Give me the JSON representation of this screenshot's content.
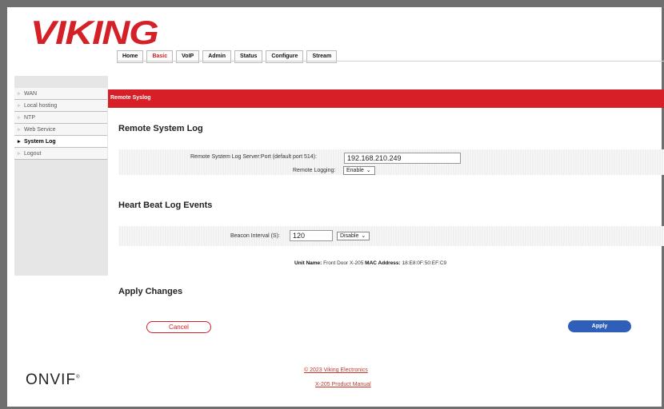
{
  "brand": {
    "logo": "VIKING"
  },
  "tabs": [
    "Home",
    "Basic",
    "VoIP",
    "Admin",
    "Status",
    "Configure",
    "Stream"
  ],
  "active_tab": "Basic",
  "sidebar": {
    "items": [
      {
        "label": "WAN"
      },
      {
        "label": "Local hosting"
      },
      {
        "label": "NTP"
      },
      {
        "label": "Web Service"
      },
      {
        "label": "System Log"
      },
      {
        "label": "Logout"
      }
    ],
    "active": "System Log"
  },
  "section_bar": {
    "title": "Remote Syslog"
  },
  "remote_log": {
    "heading": "Remote System Log",
    "server_label": "Remote System Log Server:Port (default port 514):",
    "server_value": "192.168.210.249",
    "logging_label": "Remote Logging:",
    "logging_value": "Enable"
  },
  "heartbeat": {
    "heading": "Heart Beat Log Events",
    "interval_label": "Beacon Interval (S):",
    "interval_value": "120",
    "state_value": "Disable"
  },
  "unit_info": {
    "name_label": "Unit Name:",
    "name_value": "Front Door X-205",
    "mac_label": "MAC Address:",
    "mac_value": "18:E8:0F:50:EF:C9"
  },
  "apply_section": {
    "heading": "Apply Changes",
    "cancel_label": "Cancel",
    "apply_label": "Apply"
  },
  "footer": {
    "onvif_logo": "ONVIF",
    "copyright": "© 2023 Viking Electronics",
    "manual_link": "X-205 Product Manual"
  },
  "colors": {
    "brand_red": "#d61f26",
    "apply_blue": "#2f5fb8"
  }
}
